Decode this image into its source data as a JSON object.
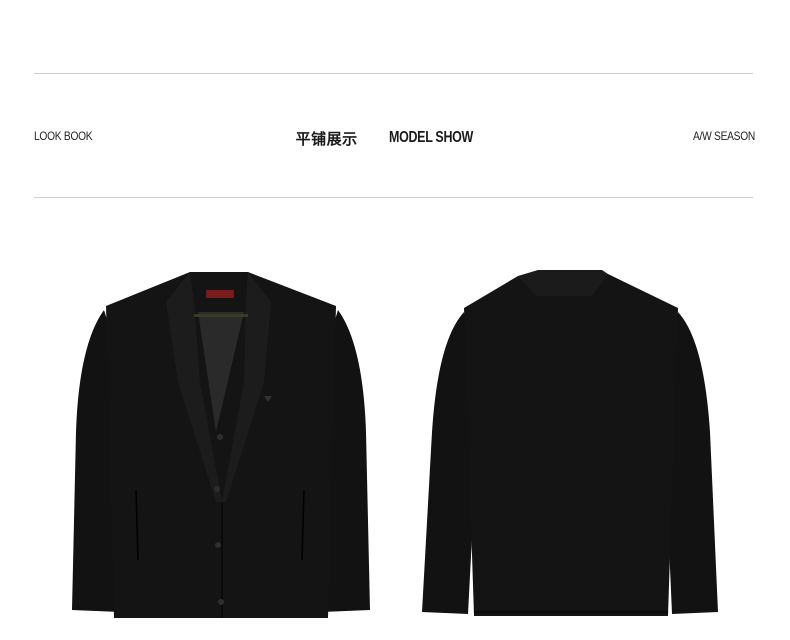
{
  "header": {
    "left_label": "LOOK BOOK",
    "title_cn": "平铺展示",
    "title_en": "MODEL SHOW",
    "right_label": "A/W SEASON"
  },
  "photos": [
    {
      "name": "cardigan-front",
      "view": "front"
    },
    {
      "name": "cardigan-back",
      "view": "back"
    }
  ],
  "colors": {
    "garment": "#111111",
    "rule": "#cfcfcf",
    "text": "#222222",
    "label_accent": "#8a1c1c"
  }
}
